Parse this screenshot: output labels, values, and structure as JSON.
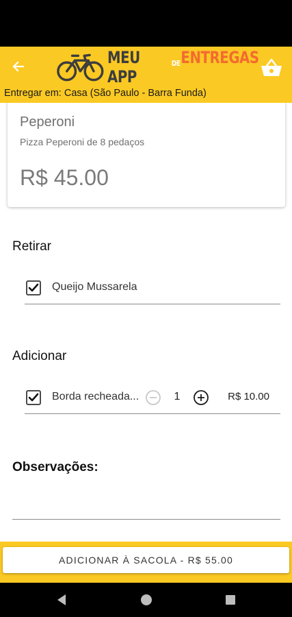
{
  "header": {
    "logo": {
      "word1": "MEU APP",
      "word2": "DE",
      "word3": "ENTREGAS"
    },
    "delivery_text": "Entregar em: Casa (São Paulo - Barra Funda)",
    "back_icon": "arrow-left-icon",
    "cart_icon": "basket-icon"
  },
  "product": {
    "name": "Peperoni",
    "description": "Pizza Peperoni de 8 pedaços",
    "price": "R$ 45.00"
  },
  "remove_section": {
    "title": "Retirar",
    "items": [
      {
        "label": "Queijo Mussarela",
        "checked": true
      }
    ]
  },
  "add_section": {
    "title": "Adicionar",
    "items": [
      {
        "label": "Borda recheada...",
        "checked": true,
        "quantity": "1",
        "price": "R$ 10.00"
      }
    ]
  },
  "observations": {
    "title": "Observações:",
    "value": "",
    "placeholder": ""
  },
  "footer": {
    "button_label": "ADICIONAR À SACOLA - R$ 55.00"
  },
  "colors": {
    "header_bg": "#fbc923",
    "logo_dark": "#3d3d3d",
    "logo_accent": "#f36b2f"
  }
}
